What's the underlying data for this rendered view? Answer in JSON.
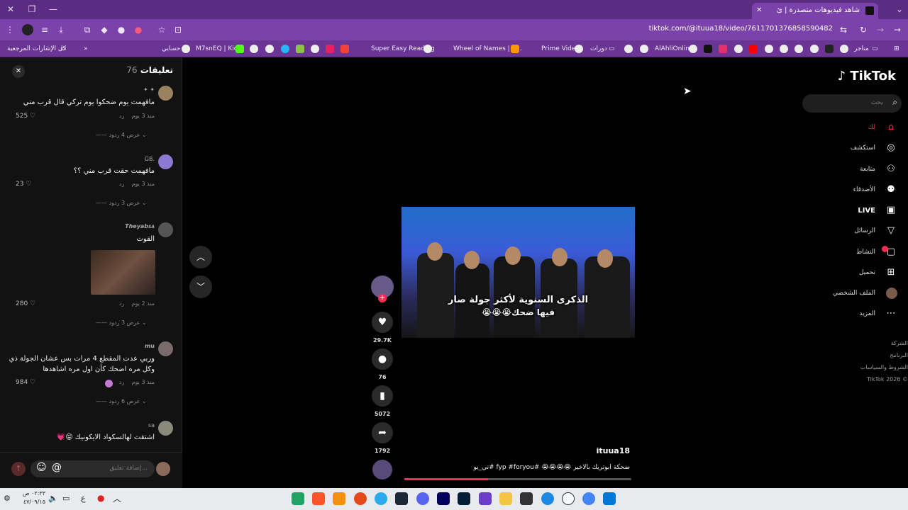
{
  "browser": {
    "tab_title": "شاهد فيديوهات متصدرة | ئ",
    "url": "tiktok.com/@ituua18/video/7611701376858590482",
    "bookmarks": [
      "كل الإشارات المرجعية",
      "حسابي",
      "M7snEQ | Kick",
      "Super Easy Reading",
      "Wheel of Names | م...",
      "Prime Video",
      "دورات",
      "AlAhliOnline",
      "متاجر"
    ]
  },
  "comments": {
    "title": "تعليقات",
    "count": "76",
    "items": [
      {
        "user": "",
        "text": "مافهمت يوم ضحكوا يوم تركي قال قرب مني",
        "time": "منذ 3 يوم",
        "reply": "رد",
        "likes": "525",
        "more": "عرض 4 ردود"
      },
      {
        "user": "GB.",
        "text": "مافهمت حقت قرب مني ؟؟",
        "time": "منذ 3 يوم",
        "reply": "رد",
        "likes": "23",
        "more": "عرض 3 ردود"
      },
      {
        "user": "Theyab",
        "user_suffix": "SA",
        "text": "القوت",
        "time": "منذ 2 يوم",
        "reply": "رد",
        "likes": "280",
        "more": "عرض 3 ردود"
      },
      {
        "user": "mu",
        "text": "وربي عدت المقطع 4 مرات بس عشان الجولة ذي",
        "text2": "وكل مره اضحك كأن اول مره اشاهدها",
        "time": "منذ 3 يوم",
        "reply": "رد",
        "likes": "984",
        "more": "عرض 6 ردود"
      },
      {
        "user": "sa",
        "text": "اشتقت لهالسكواد الايكونيك 😝💗"
      }
    ],
    "input_placeholder": "إضافة تعليق..."
  },
  "video": {
    "caption_line1": "الذكرى السنوية لأكثر جولة صار",
    "caption_line2": "فيها ضحك😭😭😭",
    "author": "ituua18",
    "description": "ضحكة ابوتريك بالاخير 😭😭😭😭 #fyp #foryou #تي_يو",
    "likes": "29.7K",
    "comments": "76",
    "saves": "5072",
    "shares": "1792"
  },
  "nav": {
    "brand": "TikTok",
    "search_placeholder": "بحث",
    "items": [
      "لك",
      "استكشف",
      "متابعة",
      "الأصدقاء",
      "LIVE",
      "الرسائل",
      "النشاط",
      "تحميل",
      "الملف الشخصي",
      "المزيد"
    ],
    "footer": [
      "الشركة",
      "البرنامج",
      "الشروط والسياسات",
      "TikTok 2026 ©"
    ]
  },
  "taskbar": {
    "time": "٠٢:٣٣ ص",
    "date": "٤٧/٠٩/١٥",
    "lang": "ع"
  }
}
